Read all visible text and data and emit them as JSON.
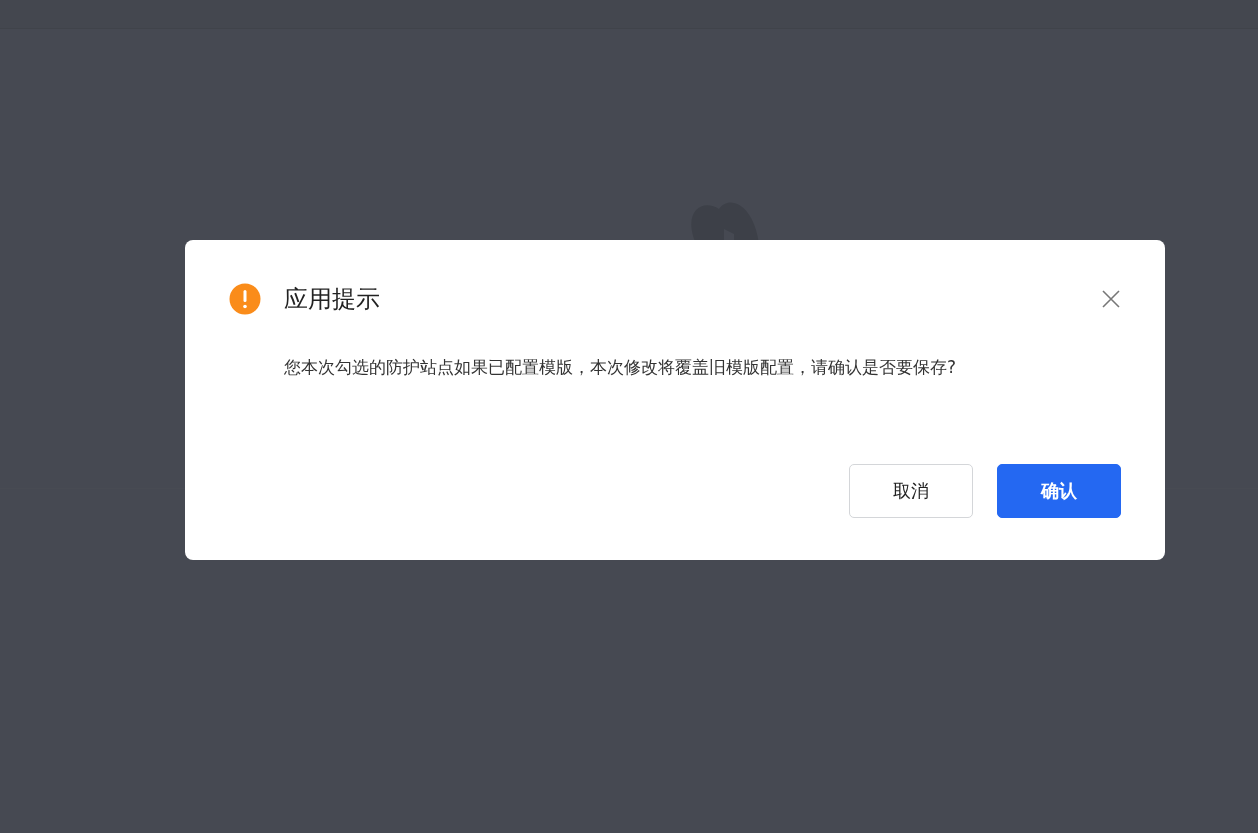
{
  "dialog": {
    "title": "应用提示",
    "message": "您本次勾选的防护站点如果已配置模版，本次修改将覆盖旧模版配置，请确认是否要保存?",
    "buttons": [
      {
        "label": "取消",
        "kind": "secondary"
      },
      {
        "label": "确认",
        "kind": "primary"
      }
    ]
  }
}
